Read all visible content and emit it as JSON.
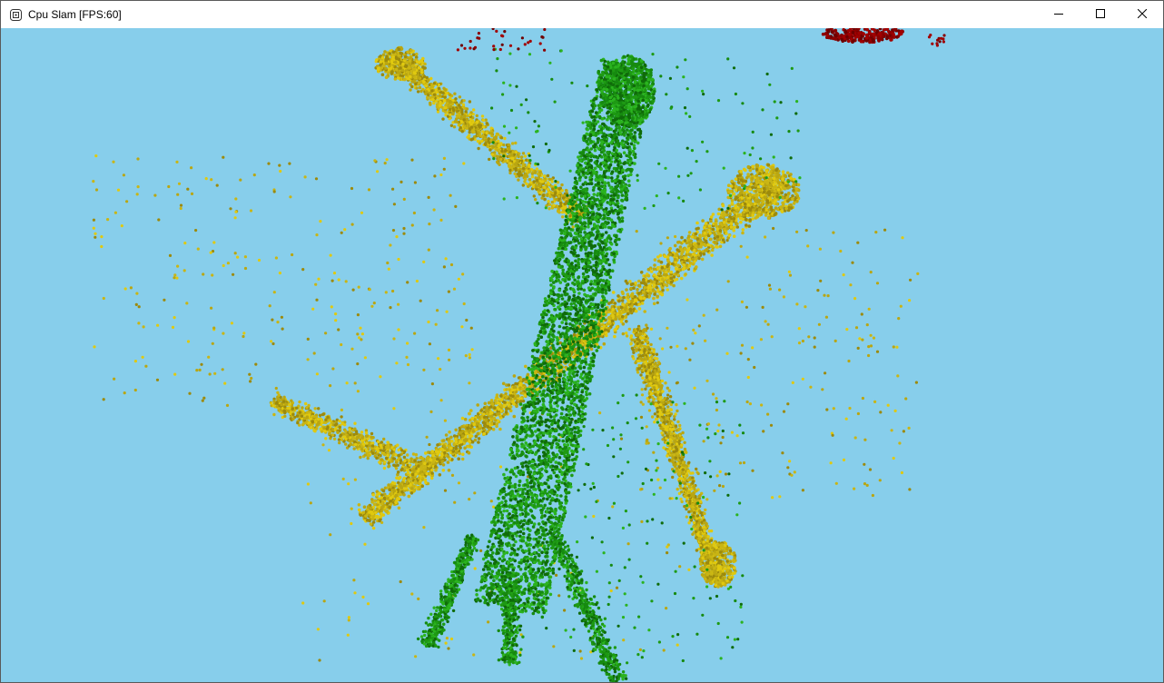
{
  "window": {
    "title": "Cpu Slam [FPS:60]",
    "icon": "app-window-icon",
    "controls": {
      "minimize_icon": "minimize-icon",
      "maximize_icon": "maximize-icon",
      "close_icon": "close-icon"
    }
  },
  "viewport": {
    "background": "#87ceeb",
    "colors": {
      "green_cloud": "#1e9a14",
      "green_dark": "#0f6b0a",
      "yellow_cloud": "#b9a612",
      "yellow_light": "#e0c90f",
      "red_cloud": "#8a0000"
    }
  }
}
